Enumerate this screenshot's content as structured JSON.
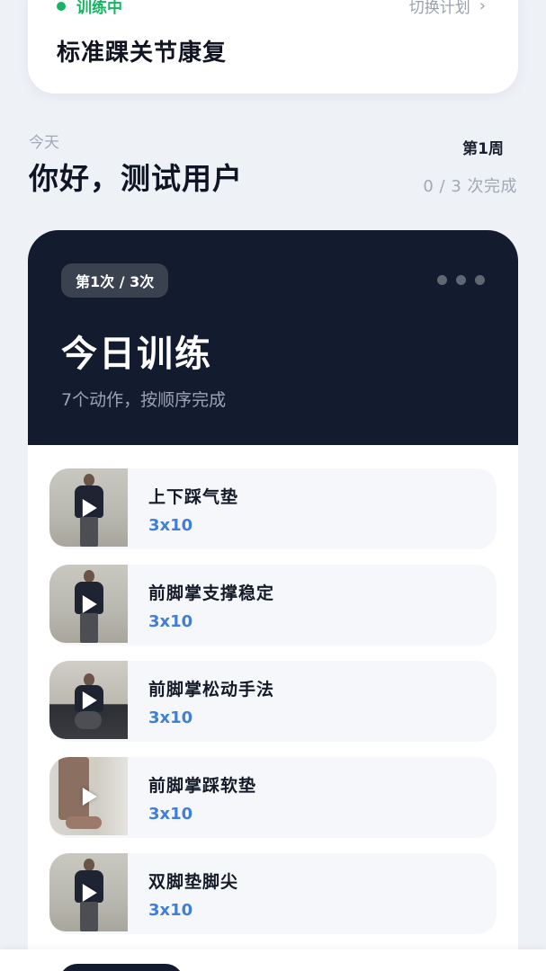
{
  "plan": {
    "status": "训练中",
    "switch_label": "切换计划",
    "title": "标准踝关节康复",
    "status_color": "#16b463"
  },
  "greeting": {
    "today": "今天",
    "hello": "你好，测试用户",
    "week": "第1周",
    "progress": "0 / 3 次完成"
  },
  "training": {
    "session": "第1次 / 3次",
    "title": "今日训练",
    "subtitle": "7个动作，按顺序完成",
    "exercises": [
      {
        "name": "上下踩气垫",
        "reps": "3x10",
        "thumb": "standing"
      },
      {
        "name": "前脚掌支撑稳定",
        "reps": "3x10",
        "thumb": "standing"
      },
      {
        "name": "前脚掌松动手法",
        "reps": "3x10",
        "thumb": "seated"
      },
      {
        "name": "前脚掌踩软垫",
        "reps": "3x10",
        "thumb": "feet"
      },
      {
        "name": "双脚垫脚尖",
        "reps": "3x10",
        "thumb": "standing"
      }
    ]
  },
  "colors": {
    "background": "#eef1f6",
    "card_dark": "#131b2e",
    "reps_blue": "#3f7fd6"
  }
}
